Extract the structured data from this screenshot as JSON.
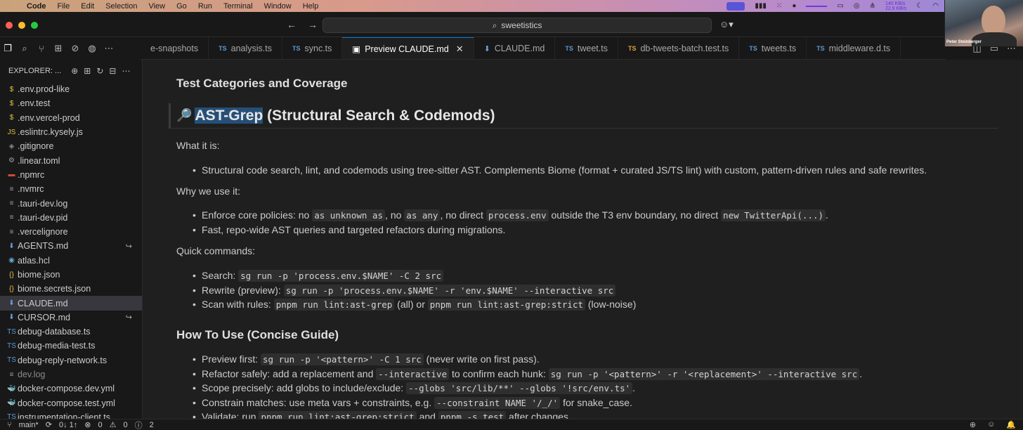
{
  "menubar": {
    "app": "Code",
    "items": [
      "File",
      "Edit",
      "Selection",
      "View",
      "Go",
      "Run",
      "Terminal",
      "Window",
      "Help"
    ],
    "network": [
      "140 KB/s",
      "22,9 KB/s"
    ]
  },
  "webcam": {
    "name": "Peter Steinberger"
  },
  "titlebar": {
    "search": "sweetistics"
  },
  "tabs": [
    {
      "label": "e-snapshots",
      "kind": "none"
    },
    {
      "label": "analysis.ts",
      "kind": "ts"
    },
    {
      "label": "sync.ts",
      "kind": "ts"
    },
    {
      "label": "Preview CLAUDE.md",
      "kind": "preview",
      "active": true
    },
    {
      "label": "CLAUDE.md",
      "kind": "md"
    },
    {
      "label": "tweet.ts",
      "kind": "ts"
    },
    {
      "label": "db-tweets-batch.test.ts",
      "kind": "ts-orange"
    },
    {
      "label": "tweets.ts",
      "kind": "ts"
    },
    {
      "label": "middleware.d.ts",
      "kind": "ts"
    }
  ],
  "explorer": {
    "title": "EXPLORER: ...",
    "files": [
      {
        "name": ".env.prod-like",
        "icon": "$",
        "color": "#e2c043"
      },
      {
        "name": ".env.test",
        "icon": "$",
        "color": "#e2c043"
      },
      {
        "name": ".env.vercel-prod",
        "icon": "$",
        "color": "#e2c043"
      },
      {
        "name": ".eslintrc.kysely.js",
        "icon": "JS",
        "color": "#e2c043"
      },
      {
        "name": ".gitignore",
        "icon": "◈",
        "color": "#8a8a8a"
      },
      {
        "name": ".linear.toml",
        "icon": "⚙",
        "color": "#9aa0a6"
      },
      {
        "name": ".npmrc",
        "icon": "▬",
        "color": "#cc4c3a"
      },
      {
        "name": ".nvmrc",
        "icon": "≡",
        "color": "#9aa0a6"
      },
      {
        "name": ".tauri-dev.log",
        "icon": "≡",
        "color": "#9aa0a6"
      },
      {
        "name": ".tauri-dev.pid",
        "icon": "≡",
        "color": "#9aa0a6"
      },
      {
        "name": ".vercelignore",
        "icon": "≡",
        "color": "#9aa0a6"
      },
      {
        "name": "AGENTS.md",
        "icon": "⬇",
        "color": "#6aa0d8",
        "badge": "↪"
      },
      {
        "name": "atlas.hcl",
        "icon": "◉",
        "color": "#5fa8d3"
      },
      {
        "name": "biome.json",
        "icon": "{}",
        "color": "#e2c043"
      },
      {
        "name": "biome.secrets.json",
        "icon": "{}",
        "color": "#e2c043"
      },
      {
        "name": "CLAUDE.md",
        "icon": "⬇",
        "color": "#6aa0d8",
        "selected": true
      },
      {
        "name": "CURSOR.md",
        "icon": "⬇",
        "color": "#6aa0d8",
        "badge": "↪"
      },
      {
        "name": "debug-database.ts",
        "icon": "TS",
        "color": "#5b9bd5"
      },
      {
        "name": "debug-media-test.ts",
        "icon": "TS",
        "color": "#5b9bd5"
      },
      {
        "name": "debug-reply-network.ts",
        "icon": "TS",
        "color": "#5b9bd5"
      },
      {
        "name": "dev.log",
        "icon": "≡",
        "color": "#9aa0a6",
        "dim": true
      },
      {
        "name": "docker-compose.dev.yml",
        "icon": "🐳",
        "color": "#e05573"
      },
      {
        "name": "docker-compose.test.yml",
        "icon": "🐳",
        "color": "#e05573"
      },
      {
        "name": "instrumentation-client.ts",
        "icon": "TS",
        "color": "#5b9bd5"
      }
    ]
  },
  "doc": {
    "h_test": "Test Categories and Coverage",
    "h_ast_emoji": "🔎",
    "h_ast_hl": "AST-Grep",
    "h_ast_rest": " (Structural Search & Codemods)",
    "what_label": "What it is:",
    "what_1": "Structural code search, lint, and codemods using tree-sitter AST. Complements Biome (format + curated JS/TS lint) with custom, pattern-driven rules and safe rewrites.",
    "why_label": "Why we use it:",
    "why_1_a": "Enforce core policies: no ",
    "why_1_c1": "as unknown as",
    "why_1_b": ", no ",
    "why_1_c2": "as any",
    "why_1_c": ", no direct ",
    "why_1_c3": "process.env",
    "why_1_d": " outside the T3 env boundary, no direct ",
    "why_1_c4": "new TwitterApi(...)",
    "why_1_e": ".",
    "why_2": "Fast, repo-wide AST queries and targeted refactors during migrations.",
    "quick_label": "Quick commands:",
    "q1_a": "Search: ",
    "q1_c": "sg run -p 'process.env.$NAME' -C 2 src",
    "q2_a": "Rewrite (preview): ",
    "q2_c": "sg run -p 'process.env.$NAME' -r 'env.$NAME' --interactive src",
    "q3_a": "Scan with rules: ",
    "q3_c1": "pnpm run lint:ast-grep",
    "q3_b": " (all) or ",
    "q3_c2": "pnpm run lint:ast-grep:strict",
    "q3_d": " (low-noise)",
    "h_how": "How To Use (Concise Guide)",
    "h1_a": "Preview first: ",
    "h1_c": "sg run -p '<pattern>' -C 1 src",
    "h1_b": " (never write on first pass).",
    "h2_a": "Refactor safely: add a replacement and ",
    "h2_c1": "--interactive",
    "h2_b": " to confirm each hunk: ",
    "h2_c2": "sg run -p '<pattern>' -r '<replacement>' --interactive src",
    "h2_d": ".",
    "h3_a": "Scope precisely: add globs to include/exclude: ",
    "h3_c": "--globs 'src/lib/**' --globs '!src/env.ts'",
    "h3_b": ".",
    "h4_a": "Constrain matches: use meta vars + constraints, e.g. ",
    "h4_c": "--constraint NAME '/_/'",
    "h4_b": " for snake_case.",
    "h5_a": "Validate: run ",
    "h5_c1": "pnpm run lint:ast-grep:strict",
    "h5_b": " and ",
    "h5_c2": "pnpm -s test",
    "h5_d": " after changes."
  },
  "status": {
    "branch": "main*",
    "sync": "0↓ 1↑",
    "problems": "0",
    "warnings": "0",
    "info": "2"
  }
}
